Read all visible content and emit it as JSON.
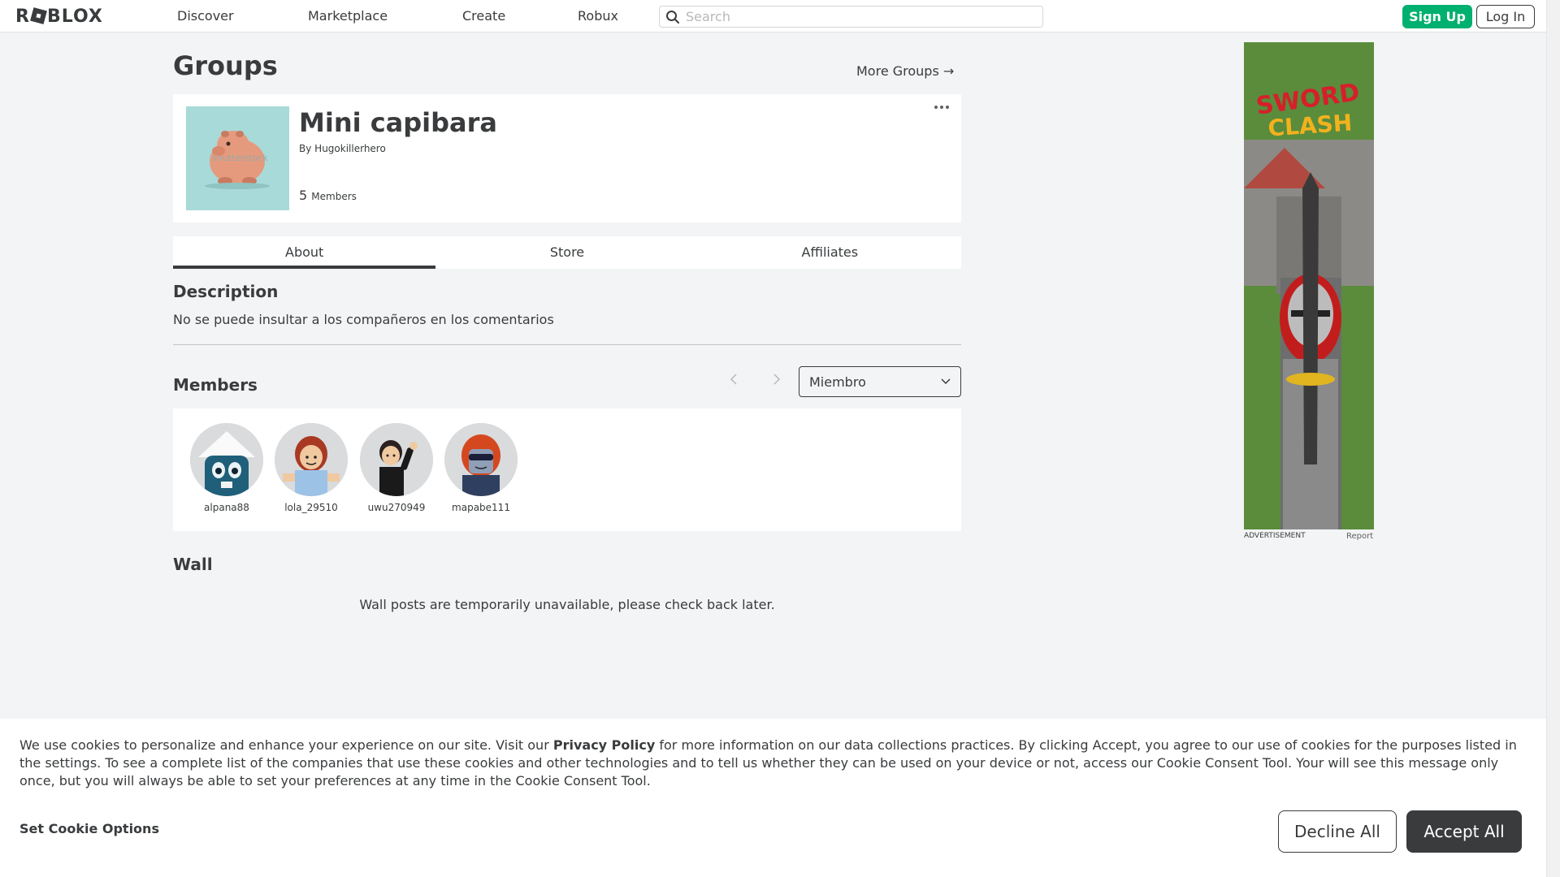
{
  "header": {
    "logo": "ROBLOX",
    "nav": [
      "Discover",
      "Marketplace",
      "Create",
      "Robux"
    ],
    "search_placeholder": "Search",
    "signup_label": "Sign Up",
    "login_label": "Log In"
  },
  "page": {
    "title": "Groups",
    "more_groups": "More Groups →"
  },
  "group": {
    "name": "Mini capibara",
    "by_prefix": "By",
    "owner": "Hugokillerhero",
    "member_count": "5",
    "member_label": "Members",
    "emblem_watermark": "shutterstock",
    "menu_icon": "more-horizontal-icon"
  },
  "tabs": [
    {
      "label": "About",
      "active": true
    },
    {
      "label": "Store",
      "active": false
    },
    {
      "label": "Affiliates",
      "active": false
    }
  ],
  "description": {
    "title": "Description",
    "text": "No se puede insultar a los compañeros en los comentarios"
  },
  "members": {
    "title": "Members",
    "role_select": "Miembro",
    "list": [
      {
        "name": "alpana88"
      },
      {
        "name": "lola_29510"
      },
      {
        "name": "uwu270949"
      },
      {
        "name": "mapabe111"
      }
    ]
  },
  "wall": {
    "title": "Wall",
    "message": "Wall posts are temporarily unavailable, please check back later."
  },
  "ad": {
    "game_title_1": "SWORD",
    "game_title_2": "CLASH",
    "label": "ADVERTISEMENT",
    "report": "Report"
  },
  "cookie": {
    "text_1": "We use cookies to personalize and enhance your experience on our site. Visit our ",
    "privacy_link": "Privacy Policy",
    "text_2": " for more information on our data collections practices. By clicking Accept, you agree to our use of cookies for the purposes listed in the settings. To see a complete list of the companies that use these cookies and other technologies and to tell us whether they can be used on your device or not, access our Cookie Consent Tool. Your will see this message only once, but you will always be able to set your preferences at any time in the Cookie Consent Tool.",
    "options_label": "Set Cookie Options",
    "decline_label": "Decline All",
    "accept_label": "Accept All"
  },
  "colors": {
    "brand_green": "#00b06f",
    "text_dark": "#393b3d",
    "background": "#f2f4f5",
    "emblem_bg": "#a8dad9"
  }
}
